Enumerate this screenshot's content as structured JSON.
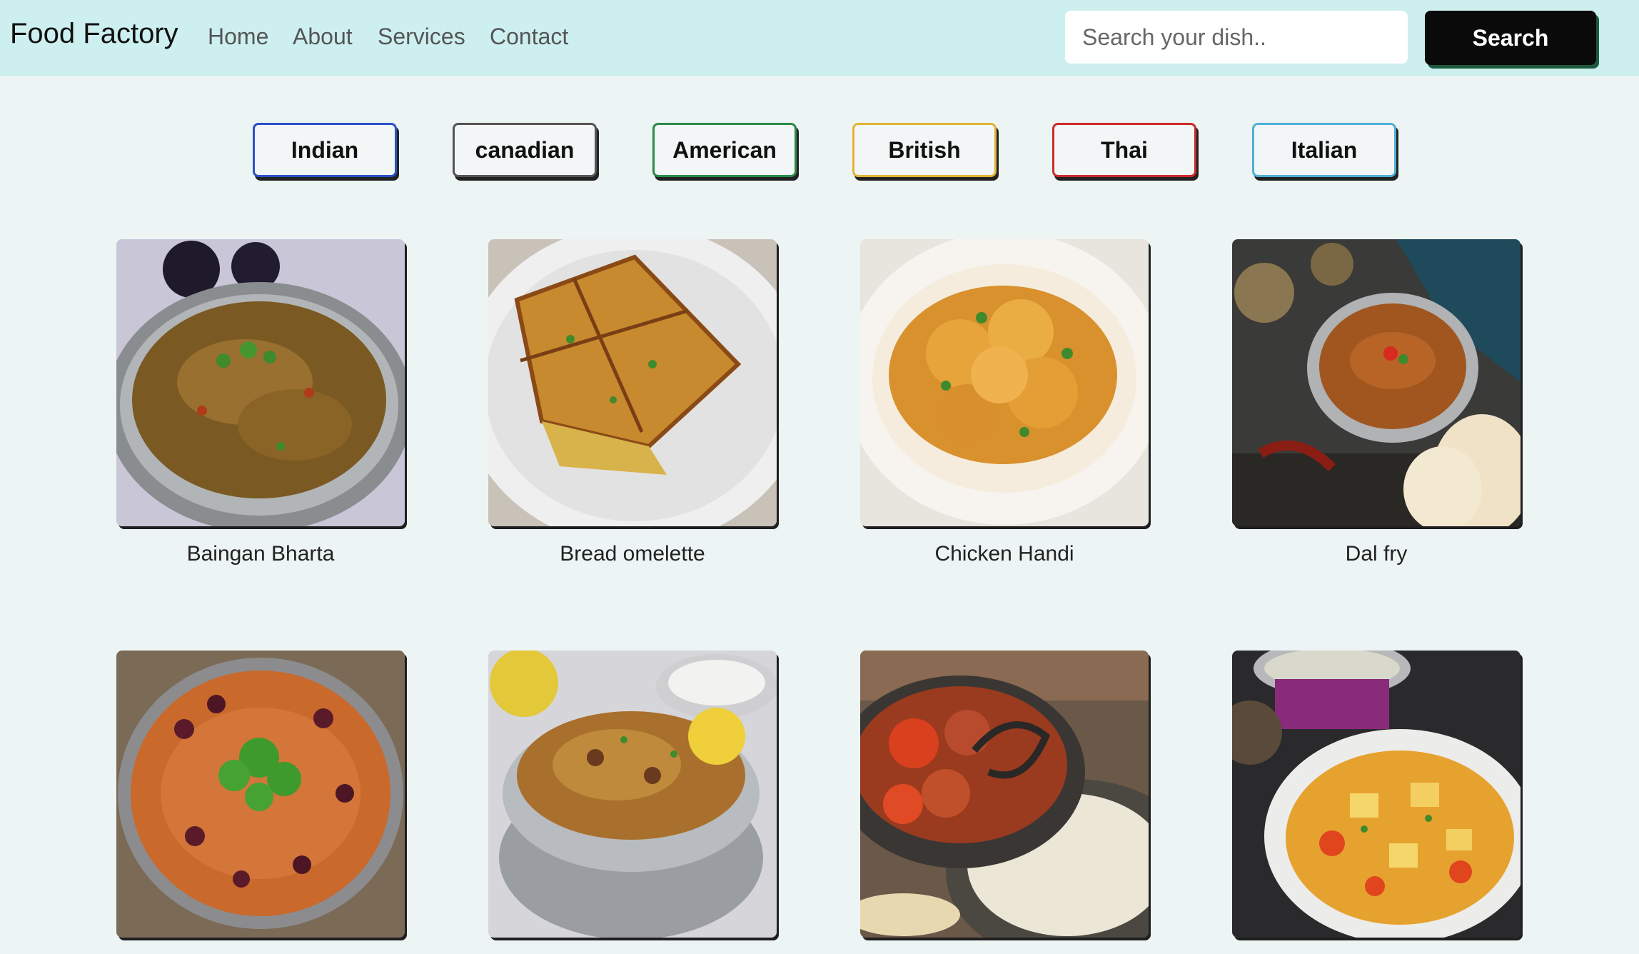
{
  "nav": {
    "brand": "Food Factory",
    "links": [
      "Home",
      "About",
      "Services",
      "Contact"
    ],
    "search": {
      "placeholder": "Search your dish..",
      "button_label": "Search"
    }
  },
  "categories": [
    {
      "label": "Indian",
      "color": "#2a50c8"
    },
    {
      "label": "canadian",
      "color": "#555555"
    },
    {
      "label": "American",
      "color": "#2b8a4a"
    },
    {
      "label": "British",
      "color": "#e0b536"
    },
    {
      "label": "Thai",
      "color": "#cc2a2a"
    },
    {
      "label": "Italian",
      "color": "#4fb0d6"
    }
  ],
  "dishes": [
    {
      "name": "Baingan Bharta"
    },
    {
      "name": "Bread omelette"
    },
    {
      "name": "Chicken Handi"
    },
    {
      "name": "Dal fry"
    },
    {
      "name": ""
    },
    {
      "name": ""
    },
    {
      "name": ""
    },
    {
      "name": ""
    }
  ]
}
